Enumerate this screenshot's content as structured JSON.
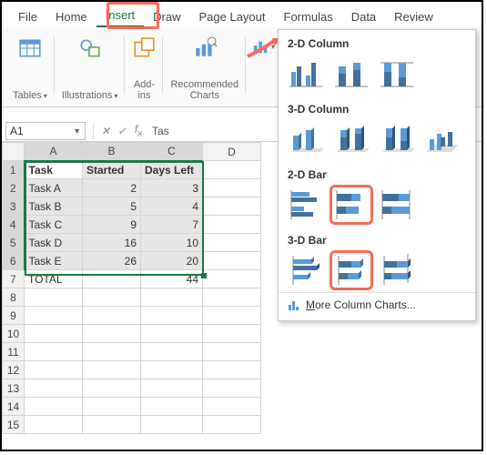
{
  "tabs": [
    "File",
    "Home",
    "Insert",
    "Draw",
    "Page Layout",
    "Formulas",
    "Data",
    "Review"
  ],
  "active_tab": "Insert",
  "ribbon": {
    "tables": "Tables",
    "illustrations": "Illustrations",
    "addins": "Add-\nins",
    "recommended": "Recommended\nCharts"
  },
  "namebox": "A1",
  "formula": "Tas",
  "columns": [
    "A",
    "B",
    "C",
    "D"
  ],
  "row_count": 15,
  "table": {
    "headers": [
      "Task",
      "Started",
      "Days Left"
    ],
    "rows": [
      {
        "task": "Task A",
        "started": 2,
        "days": 3
      },
      {
        "task": "Task B",
        "started": 5,
        "days": 4
      },
      {
        "task": "Task C",
        "started": 9,
        "days": 7
      },
      {
        "task": "Task D",
        "started": 16,
        "days": 10
      },
      {
        "task": "Task E",
        "started": 26,
        "days": 20
      }
    ],
    "total_label": "TOTAL",
    "total_value": 44
  },
  "chart_panel": {
    "sections": [
      "2-D Column",
      "3-D Column",
      "2-D Bar",
      "3-D Bar"
    ],
    "more": "More Column Charts..."
  }
}
